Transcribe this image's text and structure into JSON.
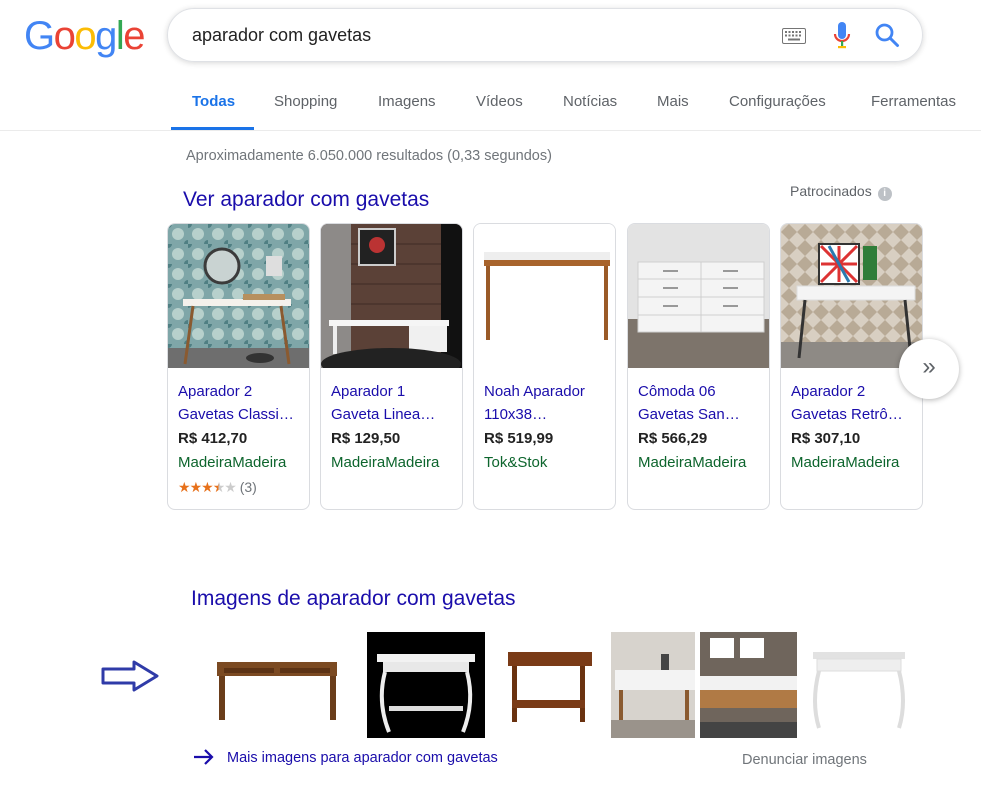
{
  "logo": {
    "letters": [
      "G",
      "o",
      "o",
      "g",
      "l",
      "e"
    ],
    "colors": [
      "#4285F4",
      "#EA4335",
      "#FBBC05",
      "#4285F4",
      "#34A853",
      "#EA4335"
    ]
  },
  "search": {
    "query": "aparador com gavetas"
  },
  "tabs": [
    {
      "label": "Todas"
    },
    {
      "label": "Shopping"
    },
    {
      "label": "Imagens"
    },
    {
      "label": "Vídeos"
    },
    {
      "label": "Notícias"
    },
    {
      "label": "Mais"
    },
    {
      "label": "Configurações"
    },
    {
      "label": "Ferramentas"
    }
  ],
  "results": {
    "stats": "Aproximadamente 6.050.000 resultados (0,33 segundos)"
  },
  "shopping": {
    "title": "Ver aparador com gavetas",
    "sponsored": "Patrocinados",
    "products": [
      {
        "line1": "Aparador 2",
        "line2": "Gavetas Classi…",
        "price": "R$ 412,70",
        "store": "MadeiraMadeira",
        "rating": 3.5,
        "reviews": "(3)"
      },
      {
        "line1": "Aparador 1",
        "line2": "Gaveta Linea…",
        "price": "R$ 129,50",
        "store": "MadeiraMadeira"
      },
      {
        "line1": "Noah Aparador",
        "line2": "110x38…",
        "price": "R$ 519,99",
        "store": "Tok&Stok"
      },
      {
        "line1": "Cômoda 06",
        "line2": "Gavetas San…",
        "price": "R$ 566,29",
        "store": "MadeiraMadeira"
      },
      {
        "line1": "Aparador 2",
        "line2": "Gavetas Retrô…",
        "price": "R$ 307,10",
        "store": "MadeiraMadeira"
      }
    ]
  },
  "images": {
    "title": "Imagens de aparador com gavetas",
    "more": "Mais imagens para aparador com gavetas",
    "report": "Denunciar imagens"
  },
  "colors": {
    "link": "#1a0dab",
    "store": "#0d652d",
    "accent": "#1a73e8",
    "star": "#e7711b"
  }
}
